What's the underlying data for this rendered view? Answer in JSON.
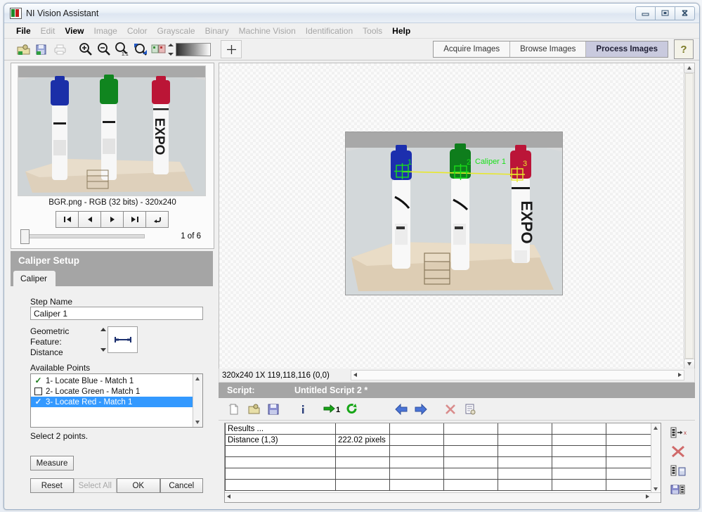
{
  "window": {
    "title": "NI Vision Assistant",
    "app_icon": "ni-vision-icon",
    "controls": {
      "minimize": "minimize-icon",
      "maximize": "maximize-icon",
      "close": "close-icon"
    }
  },
  "menubar": [
    {
      "label": "File",
      "enabled": true
    },
    {
      "label": "Edit",
      "enabled": false
    },
    {
      "label": "View",
      "enabled": true
    },
    {
      "label": "Image",
      "enabled": false
    },
    {
      "label": "Color",
      "enabled": false
    },
    {
      "label": "Grayscale",
      "enabled": false
    },
    {
      "label": "Binary",
      "enabled": false
    },
    {
      "label": "Machine Vision",
      "enabled": false
    },
    {
      "label": "Identification",
      "enabled": false
    },
    {
      "label": "Tools",
      "enabled": false
    },
    {
      "label": "Help",
      "enabled": true
    }
  ],
  "toolbar": {
    "icons": [
      "open-image-icon",
      "save-image-icon",
      "print-icon",
      "zoom-in-icon",
      "zoom-out-icon",
      "zoom-actual-size-icon",
      "zoom-fit-icon",
      "color-palette-icon"
    ],
    "gradient_bar": "grayscale-gradient",
    "cursor_tool": "crosshair-tool-icon"
  },
  "mode_tabs": {
    "items": [
      {
        "label": "Acquire Images",
        "selected": false
      },
      {
        "label": "Browse Images",
        "selected": false
      },
      {
        "label": "Process Images",
        "selected": true
      }
    ],
    "help_button": "?"
  },
  "thumbnail_panel": {
    "image_info": "BGR.png - RGB (32 bits) - 320x240",
    "nav_buttons": [
      "first-image-icon",
      "previous-image-icon",
      "next-image-icon",
      "last-image-icon",
      "loop-image-icon"
    ],
    "counter": "1  of  6"
  },
  "setup_panel": {
    "header": "Caliper Setup",
    "tab": "Caliper",
    "step_name_label": "Step Name",
    "step_name_value": "Caliper 1",
    "geometric_feature_label": "Geometric Feature:",
    "geometric_feature_value": "Distance",
    "geometric_feature_icon": "distance-measure-icon",
    "available_points_label": "Available Points",
    "available_points": [
      {
        "label": "1- Locate Blue - Match 1",
        "checked": true,
        "selected": false
      },
      {
        "label": "2- Locate Green - Match 1",
        "checked": false,
        "selected": false
      },
      {
        "label": "3- Locate Red - Match 1",
        "checked": true,
        "selected": true
      }
    ],
    "hint": "Select 2 points.",
    "measure_button": "Measure",
    "buttons": [
      {
        "label": "Reset",
        "enabled": true
      },
      {
        "label": "Select All",
        "enabled": false
      },
      {
        "label": "OK",
        "enabled": true
      },
      {
        "label": "Cancel",
        "enabled": true
      }
    ]
  },
  "canvas": {
    "overlay_label": "Caliper 1",
    "point_labels": [
      "1",
      "2",
      "3"
    ],
    "overlay_line_color": "#e8e82a",
    "overlay_green": "#19e019"
  },
  "status_bar": {
    "text": "320x240 1X 119,118,116   (0,0)"
  },
  "script_bar": {
    "label": "Script:",
    "name": "Untitled Script 2 *"
  },
  "script_toolbar": {
    "icons": [
      "new-script-icon",
      "open-script-icon",
      "save-script-icon",
      "script-info-icon",
      "run-once-icon",
      "run-continuous-icon",
      "step-back-icon",
      "step-forward-icon",
      "delete-step-icon",
      "script-report-icon"
    ]
  },
  "results": {
    "header": "Results ...",
    "columns": 7,
    "rows": [
      [
        "Distance (1,3)",
        "222.02 pixels",
        "",
        "",
        "",
        "",
        ""
      ],
      [
        "",
        "",
        "",
        "",
        "",
        "",
        ""
      ],
      [
        "",
        "",
        "",
        "",
        "",
        "",
        ""
      ],
      [
        "",
        "",
        "",
        "",
        "",
        "",
        ""
      ],
      [
        "",
        "",
        "",
        "",
        "",
        "",
        ""
      ]
    ]
  },
  "results_side_buttons": [
    "export-results-icon",
    "delete-results-icon",
    "copy-results-icon",
    "save-results-icon"
  ]
}
